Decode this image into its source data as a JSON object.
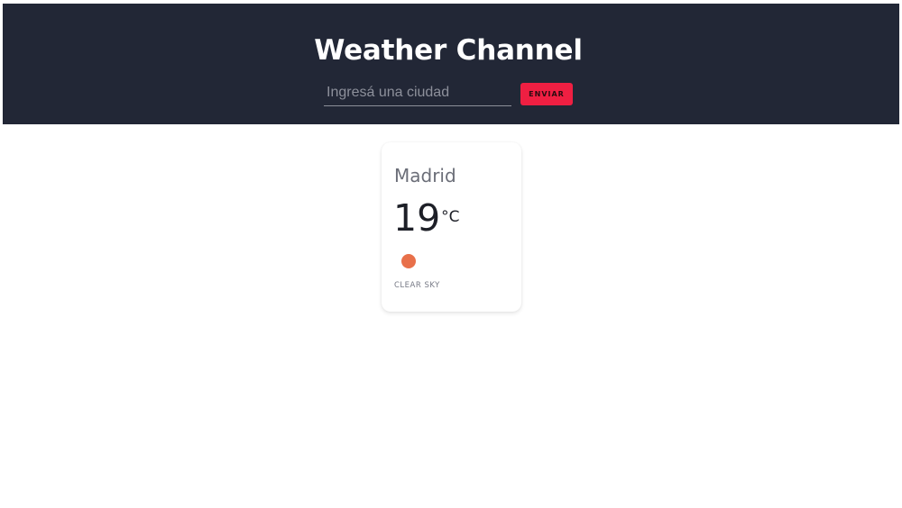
{
  "header": {
    "title": "Weather Channel",
    "search": {
      "value": "",
      "placeholder": "Ingresá una ciudad"
    },
    "send_label": "ENVIAR"
  },
  "weather_card": {
    "city": "Madrid",
    "temperature": "19",
    "unit": "°C",
    "icon": "sun-icon",
    "description": "CLEAR SKY"
  },
  "colors": {
    "header_background": "#222736",
    "send_button": "#ef1f42",
    "sun_icon": "#e8704a"
  }
}
